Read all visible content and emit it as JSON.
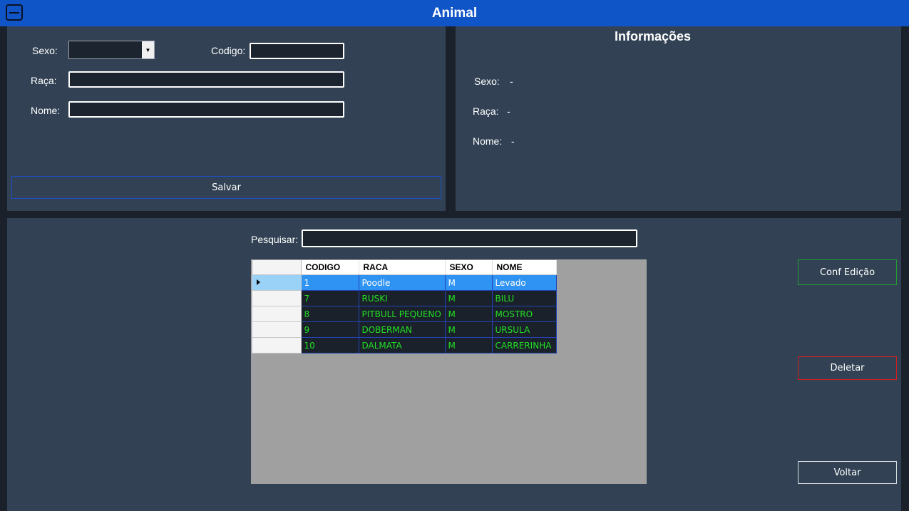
{
  "window": {
    "title": "Animal"
  },
  "form": {
    "sexo_label": "Sexo:",
    "codigo_label": "Codigo:",
    "raca_label": "Raça:",
    "nome_label": "Nome:",
    "sexo_value": "",
    "codigo_value": "",
    "raca_value": "",
    "nome_value": "",
    "save_label": "Salvar"
  },
  "info": {
    "title": "Informações",
    "sexo_label": "Sexo:",
    "sexo_value": "-",
    "raca_label": "Raça:",
    "raca_value": "-",
    "nome_label": "Nome:",
    "nome_value": "-"
  },
  "search": {
    "label": "Pesquisar:",
    "value": ""
  },
  "grid": {
    "columns": [
      "CODIGO",
      "RACA",
      "SEXO",
      "NOME"
    ],
    "selected_row": 0,
    "rows": [
      [
        "1",
        "Poodle",
        "M",
        "Levado"
      ],
      [
        "7",
        "RUSKI",
        "M",
        "BILU"
      ],
      [
        "8",
        "PITBULL PEQUENO",
        "M",
        "MOSTRO"
      ],
      [
        "9",
        "DOBERMAN",
        "M",
        "URSULA"
      ],
      [
        "10",
        "DALMATA",
        "M",
        "CARRERINHA"
      ]
    ]
  },
  "actions": {
    "edit_label": "Conf Edição",
    "delete_label": "Deletar",
    "back_label": "Voltar"
  },
  "colors": {
    "titlebar": "#0f55c8",
    "panel": "#324254",
    "row_text": "#22e022",
    "selected_row": "#2f93f3",
    "edit_border": "#1f9e2e",
    "delete_border": "#d41f1f"
  }
}
